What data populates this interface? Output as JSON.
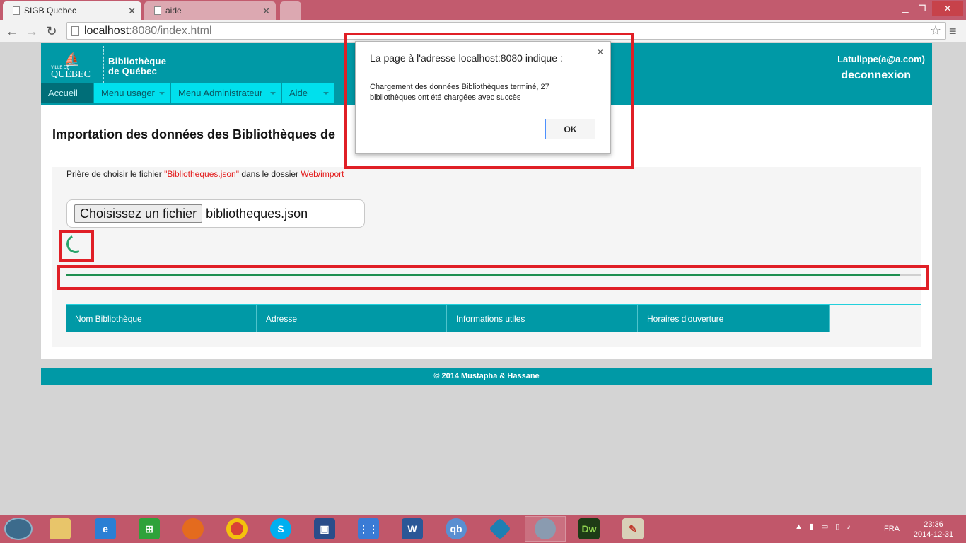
{
  "browser": {
    "tabs": [
      {
        "title": "SIGB Quebec",
        "active": true
      },
      {
        "title": "aide",
        "active": false
      }
    ],
    "url_host": "localhost",
    "url_path": ":8080/index.html"
  },
  "header": {
    "logo_line1": "VILLE DE",
    "logo_line2": "QUÉBEC",
    "title_line1": "Bibliothèque",
    "title_line2": "de Québec",
    "user_email": "Latulippe(a@a.com)",
    "logout": "deconnexion"
  },
  "nav": [
    {
      "label": "Accueil",
      "active": true,
      "dropdown": false
    },
    {
      "label": "Menu usager",
      "active": false,
      "dropdown": true
    },
    {
      "label": "Menu Administrateur",
      "active": false,
      "dropdown": true
    },
    {
      "label": "Aide",
      "active": false,
      "dropdown": true
    }
  ],
  "main": {
    "heading": "Importation des données des Bibliothèques de",
    "instructions_prefix": "Prière de choisir le fichier ",
    "instructions_file": "\"Bibliotheques.json\"",
    "instructions_middle": " dans le dossier ",
    "instructions_folder": "Web/import",
    "file_button": "Choisissez un fichier",
    "file_name": "bibliotheques.json",
    "progress_fraction": 0.975,
    "table_headers": [
      "Nom Bibliothèque",
      "Adresse",
      "Informations utiles",
      "Horaires d'ouverture"
    ]
  },
  "footer": "© 2014 Mustapha & Hassane",
  "dialog": {
    "title": "La page à l'adresse localhost:8080 indique :",
    "message": "Chargement des données Bibliothèques terminé, 27 bibliothèques ont été chargées avec succès",
    "ok": "OK",
    "close": "×"
  },
  "taskbar": {
    "lang": "FRA",
    "time": "23:36",
    "date": "2014-12-31"
  },
  "colors": {
    "brand": "#0099a6",
    "nav": "#00e0ed",
    "highlight": "#e01f26",
    "progress": "#1f8f50"
  }
}
